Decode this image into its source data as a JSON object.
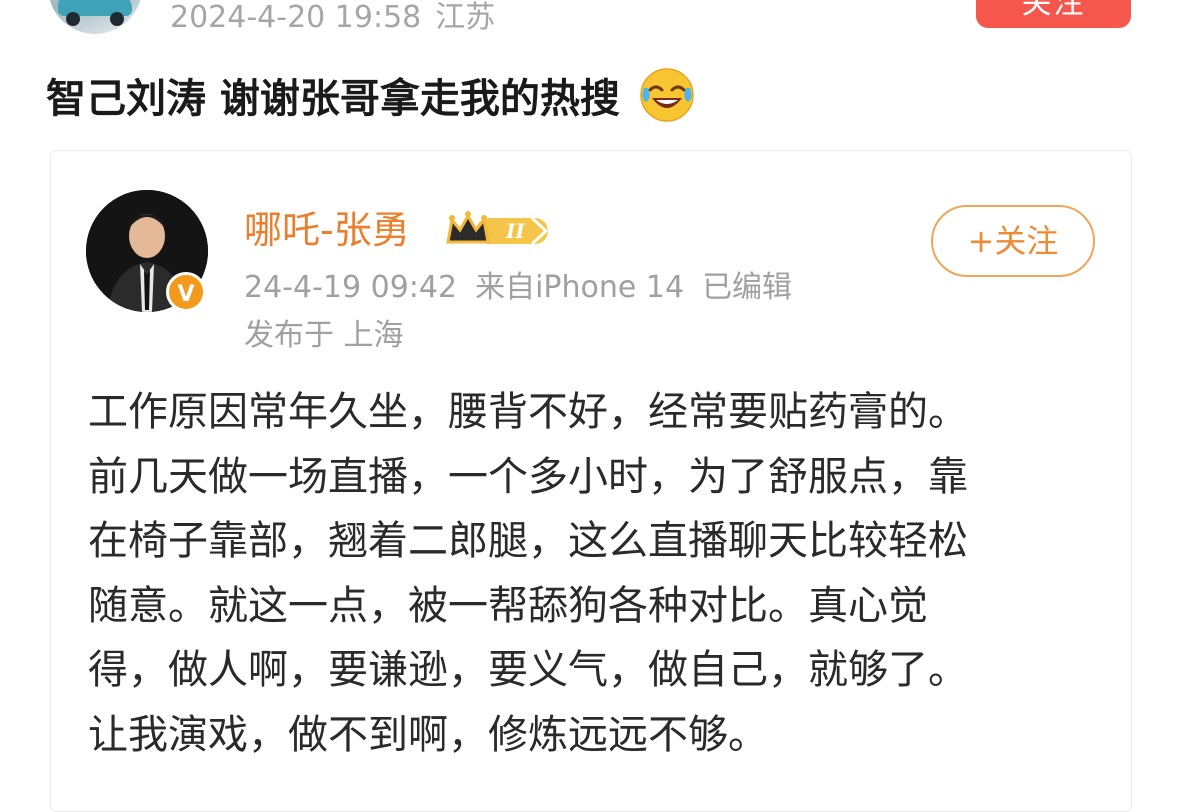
{
  "post": {
    "timestamp": "2024-4-20 19:58",
    "location": "江苏",
    "follow_label": "关注",
    "text": "智己刘涛  谢谢张哥拿走我的热搜",
    "emoji": "laughing-crying-emoji"
  },
  "quoted": {
    "author": "哪吒-张勇",
    "level_badge": "II",
    "follow_label": "+关注",
    "timestamp": "24-4-19 09:42",
    "source": "来自iPhone 14",
    "edited": "已编辑",
    "location_line": "发布于 上海",
    "verified_badge": "V",
    "body_lines": [
      "工作原因常年久坐，腰背不好，经常要贴药膏的。",
      "前几天做一场直播，一个多小时，为了舒服点，靠",
      "在椅子靠部，翘着二郎腿，这么直播聊天比较轻松",
      "随意。就这一点，被一帮舔狗各种对比。真心觉",
      "得，做人啊，要谦逊，要义气，做自己，就够了。",
      "让我演戏，做不到啊，修炼远远不够。"
    ]
  },
  "colors": {
    "follow_red": "#f5574c",
    "author_orange": "#eb7f2e",
    "meta_gray": "#a6a6a6"
  }
}
